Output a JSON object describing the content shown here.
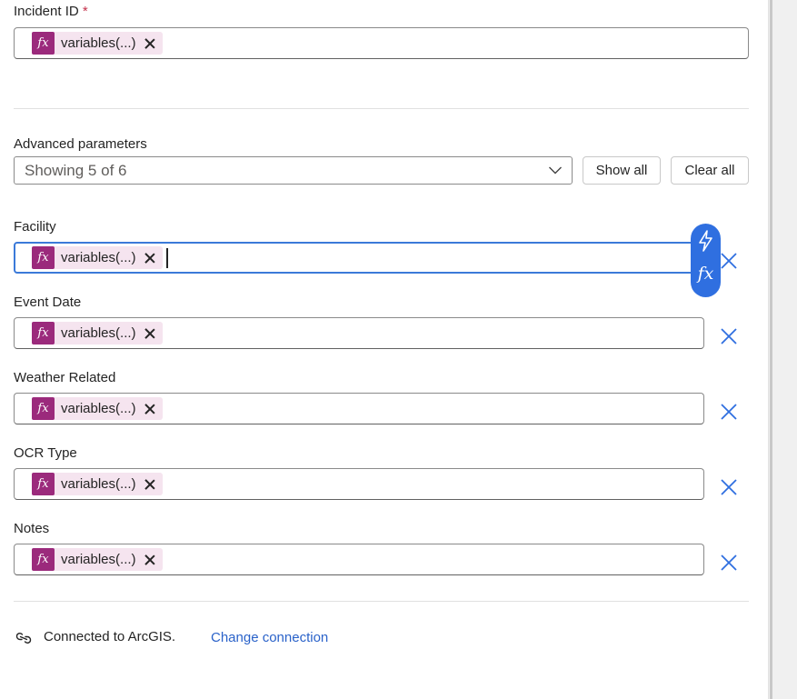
{
  "incident": {
    "label": "Incident ID",
    "required_marker": "*",
    "token": {
      "badge": "fx",
      "text": "variables(...)"
    }
  },
  "advanced": {
    "label": "Advanced parameters",
    "dropdown_value": "Showing 5 of 6",
    "show_all_label": "Show all",
    "clear_all_label": "Clear all"
  },
  "params": [
    {
      "label": "Facility",
      "token": {
        "badge": "fx",
        "text": "variables(...)"
      }
    },
    {
      "label": "Event Date",
      "token": {
        "badge": "fx",
        "text": "variables(...)"
      }
    },
    {
      "label": "Weather Related",
      "token": {
        "badge": "fx",
        "text": "variables(...)"
      }
    },
    {
      "label": "OCR Type",
      "token": {
        "badge": "fx",
        "text": "variables(...)"
      }
    },
    {
      "label": "Notes",
      "token": {
        "badge": "fx",
        "text": "variables(...)"
      }
    }
  ],
  "floating_pill": {
    "top_icon": "lightning-icon",
    "bottom_label": "fx"
  },
  "connection": {
    "icon": "link-icon",
    "text": "Connected to ArcGIS.",
    "change_label": "Change connection"
  },
  "colors": {
    "accent": "#2f6fe0",
    "token_badge": "#9b2a7c",
    "token_bg": "#f5e4ef",
    "link": "#2a62c9",
    "remove_x": "#2f6fe0"
  }
}
